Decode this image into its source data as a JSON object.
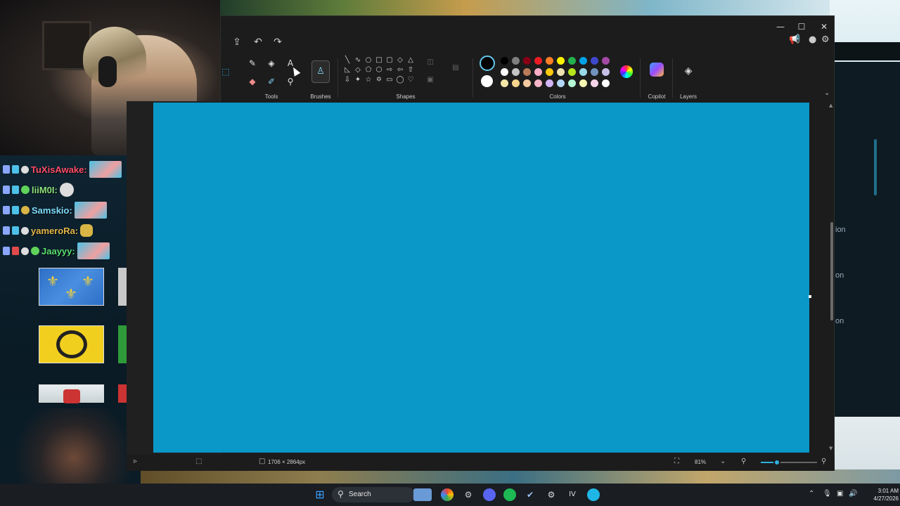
{
  "paint": {
    "title_controls": {
      "minimize": "—",
      "maximize": "☐",
      "close": "✕"
    },
    "quick_access": [
      "share-icon",
      "undo-icon",
      "redo-icon"
    ],
    "ribbon": {
      "groups": {
        "tools": "Tools",
        "brushes": "Brushes",
        "shapes": "Shapes",
        "colors": "Colors",
        "copilot": "Copilot",
        "layers": "Layers"
      }
    },
    "palette": {
      "primary": "#000000",
      "secondary": "#ffffff",
      "row1": [
        "#000000",
        "#7f7f7f",
        "#880015",
        "#ed1c24",
        "#ff7f27",
        "#fff200",
        "#22b14c",
        "#00a2e8",
        "#3f48cc",
        "#a349a4"
      ],
      "row2": [
        "#ffffff",
        "#c3c3c3",
        "#b97a57",
        "#ffaec9",
        "#ffc90e",
        "#efe4b0",
        "#b5e61d",
        "#99d9ea",
        "#7092be",
        "#c8bfe7"
      ],
      "row3": [
        "#f5e6a8",
        "#f7d58c",
        "#f5c9a0",
        "#f7b5c9",
        "#d4b5f7",
        "#b5d7f7",
        "#b5f7d4",
        "#f7f7b5",
        "#f7d4e8",
        "#ffffff"
      ]
    },
    "canvas": {
      "fill_color": "#0a98c9"
    },
    "status": {
      "canvas_size": "1706 × 2864px",
      "zoom": "81%",
      "zoom_fraction": 0.3
    }
  },
  "chat": {
    "messages": [
      {
        "user": "TuXisAwake:",
        "color": "#ff4d6a"
      },
      {
        "user": "liiM0I:",
        "color": "#8ee07c"
      },
      {
        "user": "Samskio:",
        "color": "#7fdcff"
      },
      {
        "user": "yameroRa:",
        "color": "#e5b84b"
      },
      {
        "user": "Jaayyy:",
        "color": "#59e06f"
      }
    ]
  },
  "taskbar": {
    "search_label": "Search",
    "time": "3:01 AM",
    "date": "4/27/2026"
  },
  "background_window": {
    "items": [
      "ion",
      "on",
      "on"
    ]
  }
}
